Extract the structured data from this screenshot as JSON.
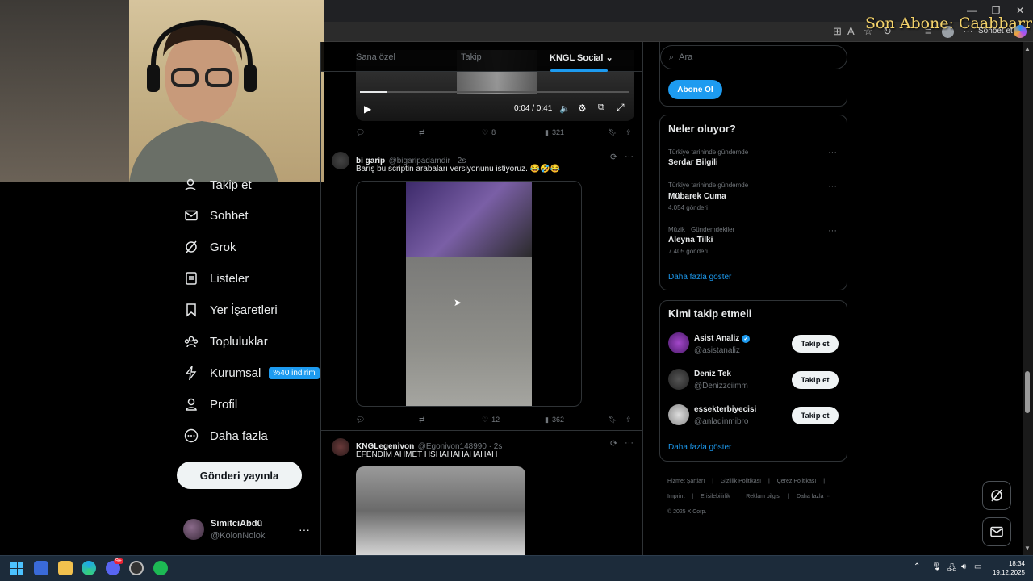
{
  "overlay": {
    "text": "Son Abone: Caabbarr"
  },
  "browser": {
    "chat_label": "Sohbet et"
  },
  "nav": {
    "items": [
      {
        "label": "Takip et"
      },
      {
        "label": "Sohbet"
      },
      {
        "label": "Grok"
      },
      {
        "label": "Listeler"
      },
      {
        "label": "Yer İşaretleri"
      },
      {
        "label": "Topluluklar"
      },
      {
        "label": "Kurumsal",
        "badge": "%40 indirim"
      },
      {
        "label": "Profil"
      },
      {
        "label": "Daha fazla"
      }
    ],
    "post_button": "Gönderi yayınla",
    "account": {
      "name": "SimitciAbdü",
      "handle": "@KolonNolok",
      "more": "···"
    }
  },
  "timeline": {
    "tabs": [
      "Sana özel",
      "Takip",
      "KNGL Social"
    ],
    "video1": {
      "time": "0:04 / 0:41",
      "progress": 0.1,
      "replies": "",
      "reposts": "",
      "likes": "8",
      "views": "321"
    },
    "tweet2": {
      "name": "bi garip",
      "handle": "@bigaripadamdir · 2s",
      "text": "Barış bu scriptin arabaları versiyonunu istiyoruz. 😂🤣😂",
      "likes": "12",
      "views": "362"
    },
    "tweet3": {
      "name": "KNGLegenivon",
      "handle": "@Egonivon148990 · 2s",
      "text": "EFENDIM AHMET HSHAHAHAHAHAH"
    }
  },
  "right": {
    "search_placeholder": "Ara",
    "subscribe_label": "Abone Ol",
    "trends_title": "Neler oluyor?",
    "trends": [
      {
        "category": "Türkiye tarihinde gündemde",
        "name": "Serdar Bilgili",
        "count": ""
      },
      {
        "category": "Türkiye tarihinde gündemde",
        "name": "Mübarek Cuma",
        "count": "4.054 gönderi"
      },
      {
        "category": "Müzik · Gündemdekiler",
        "name": "Aleyna Tilki",
        "count": "7.405 gönderi"
      }
    ],
    "trends_more": "Daha fazla göster",
    "who_title": "Kimi takip etmeli",
    "who": [
      {
        "name": "Asist Analiz",
        "handle": "@asistanaliz",
        "verified": true,
        "button": "Takip et"
      },
      {
        "name": "Deniz Tek",
        "handle": "@Denizzciimm",
        "verified": false,
        "button": "Takip et"
      },
      {
        "name": "essekterbiyecisi",
        "handle": "@anladinmibro",
        "verified": false,
        "button": "Takip et"
      }
    ],
    "who_more": "Daha fazla göster",
    "footer": [
      "Hizmet Şartları",
      "|",
      "Gizlilik Politikası",
      "|",
      "Çerez Politikası",
      "|",
      "Imprint",
      "|",
      "Erişilebilirlik",
      "|",
      "Reklam bilgisi",
      "|",
      "Daha fazla ···",
      "© 2025 X Corp."
    ]
  },
  "taskbar": {
    "time": "18:34",
    "date": "19.12.2025",
    "discord_badge": "9+"
  },
  "colors": {
    "accent": "#1d9bf0",
    "bg": "#000000",
    "border": "#2f3336",
    "muted": "#71767b"
  }
}
